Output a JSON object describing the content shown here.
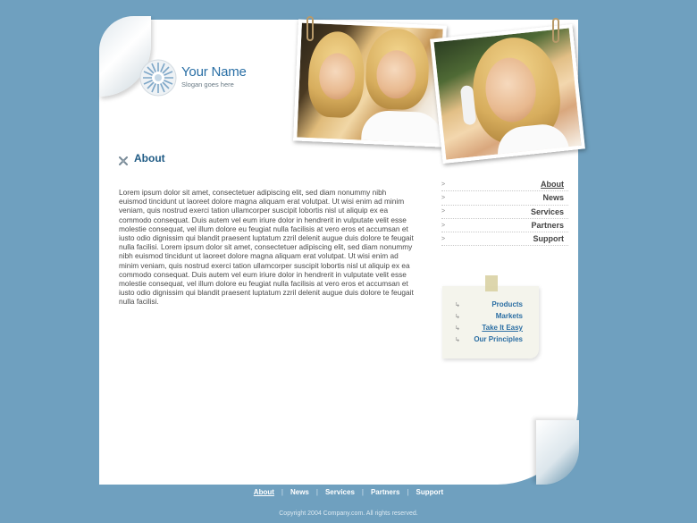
{
  "brand": {
    "name": "Your Name",
    "slogan": "Slogan goes here",
    "accent": "#2a6fa5"
  },
  "section": {
    "title": "About",
    "body": "Lorem ipsum dolor sit amet, consectetuer adipiscing elit, sed diam nonummy nibh euismod tincidunt ut laoreet dolore magna aliquam erat volutpat. Ut wisi enim ad minim veniam, quis nostrud exerci tation ullamcorper suscipit lobortis nisl ut aliquip ex ea commodo consequat. Duis autem vel eum iriure dolor in hendrerit in vulputate velit esse molestie consequat, vel illum dolore eu feugiat nulla facilisis at vero eros et accumsan et iusto odio dignissim qui blandit praesent luptatum zzril delenit augue duis dolore te feugait nulla facilisi. Lorem ipsum dolor sit amet, consectetuer adipiscing elit, sed diam nonummy nibh euismod tincidunt ut laoreet dolore magna aliquam erat volutpat. Ut wisi enim ad minim veniam, quis nostrud exerci tation ullamcorper suscipit lobortis nisl ut aliquip ex ea commodo consequat. Duis autem vel eum iriure dolor in hendrerit in vulputate velit esse molestie consequat, vel illum dolore eu feugiat nulla facilisis at vero eros et accumsan et iusto odio dignissim qui blandit praesent luptatum zzril delenit augue duis dolore te feugait nulla facilisi."
  },
  "side_nav": {
    "items": [
      {
        "label": "About",
        "active": true
      },
      {
        "label": "News"
      },
      {
        "label": "Services"
      },
      {
        "label": "Partners"
      },
      {
        "label": "Support"
      }
    ]
  },
  "note_nav": {
    "items": [
      {
        "label": "Products"
      },
      {
        "label": "Markets"
      },
      {
        "label": "Take It Easy",
        "active": true
      },
      {
        "label": "Our Principles"
      }
    ]
  },
  "footer": {
    "nav": [
      {
        "label": "About",
        "active": true
      },
      {
        "label": "News"
      },
      {
        "label": "Services"
      },
      {
        "label": "Partners"
      },
      {
        "label": "Support"
      }
    ],
    "copyright": "Copyright 2004 Company.com. All rights reserved."
  },
  "colors": {
    "background": "#6fa0bf",
    "heading": "#1f5b85"
  }
}
